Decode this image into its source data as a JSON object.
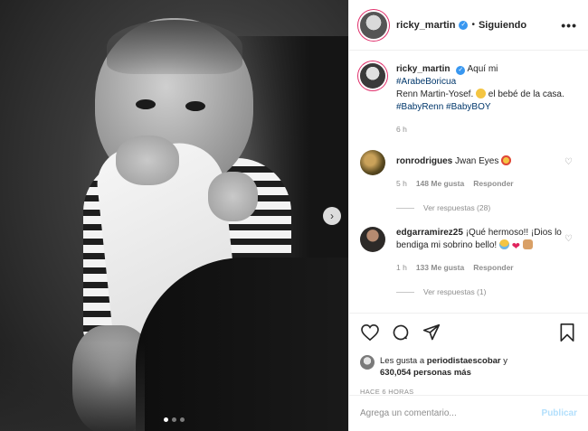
{
  "post": {
    "username": "ricky_martin",
    "follow_status": "Siguiendo",
    "more_label": "•••"
  },
  "caption": {
    "username": "ricky_martin",
    "text_1": "Aquí mi",
    "hashtag_1": "#ArabeBoricua",
    "text_2": "Renn Martin-Yosef.",
    "text_3": "el bebé de la casa.",
    "hashtag_2": "#BabyRenn",
    "hashtag_3": "#BabyBOY",
    "time": "6 h"
  },
  "comments": [
    {
      "username": "ronrodrigues",
      "text": "Jwan Eyes",
      "time": "5 h",
      "likes": "148 Me gusta",
      "reply": "Responder",
      "view_replies": "Ver respuestas (28)"
    },
    {
      "username": "edgarramirez25",
      "text": "¡Qué hermoso!! ¡Dios lo bendiga mi sobrino bello!",
      "time": "1 h",
      "likes": "133 Me gusta",
      "reply": "Responder",
      "view_replies": "Ver respuestas (1)"
    }
  ],
  "likes": {
    "prefix": "Les gusta a",
    "first_user": "periodistaescobar",
    "connector": "y",
    "count": "630,054 personas más"
  },
  "posted_ago": "HACE 6 HORAS",
  "add_comment": {
    "placeholder": "Agrega un comentario...",
    "publish": "Publicar"
  },
  "carousel": {
    "slides": 3,
    "active": 1
  },
  "colors": {
    "verified": "#3897f0",
    "hashtag": "#00376b",
    "publish_disabled": "#b2dffc"
  },
  "icons": [
    "verified-icon",
    "more-icon",
    "heart-icon",
    "comment-icon",
    "share-icon",
    "bookmark-icon",
    "chevron-right-icon"
  ]
}
